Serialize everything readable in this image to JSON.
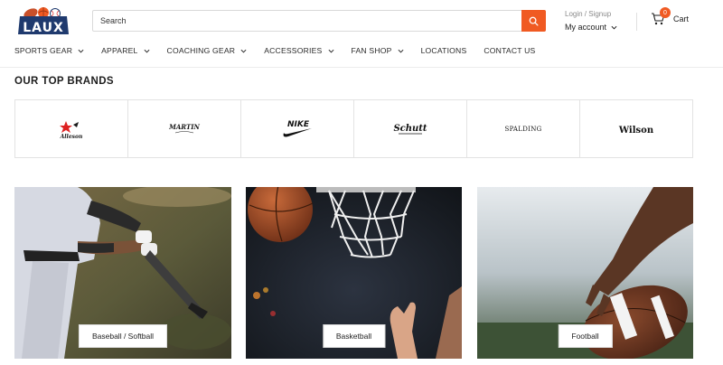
{
  "header": {
    "logo_text": "LAUX",
    "search_placeholder": "Search",
    "login_label": "Login / Signup",
    "account_label": "My account",
    "cart_count": "0",
    "cart_label": "Cart"
  },
  "nav": {
    "items": [
      {
        "label": "SPORTS GEAR",
        "dropdown": true
      },
      {
        "label": "APPAREL",
        "dropdown": true
      },
      {
        "label": "COACHING GEAR",
        "dropdown": true
      },
      {
        "label": "ACCESSORIES",
        "dropdown": true
      },
      {
        "label": "FAN SHOP",
        "dropdown": true
      },
      {
        "label": "LOCATIONS",
        "dropdown": false
      },
      {
        "label": "CONTACT US",
        "dropdown": false
      }
    ]
  },
  "brands": {
    "title": "OUR TOP BRANDS",
    "items": [
      {
        "name": "Alleson"
      },
      {
        "name": "MARTIN"
      },
      {
        "name": "NIKE"
      },
      {
        "name": "Schutt"
      },
      {
        "name": "SPALDING"
      },
      {
        "name": "Wilson"
      }
    ]
  },
  "categories": [
    {
      "label": "Baseball / Softball"
    },
    {
      "label": "Basketball"
    },
    {
      "label": "Football"
    }
  ],
  "colors": {
    "accent": "#f05a22",
    "logo_blue": "#1f3a6e"
  }
}
